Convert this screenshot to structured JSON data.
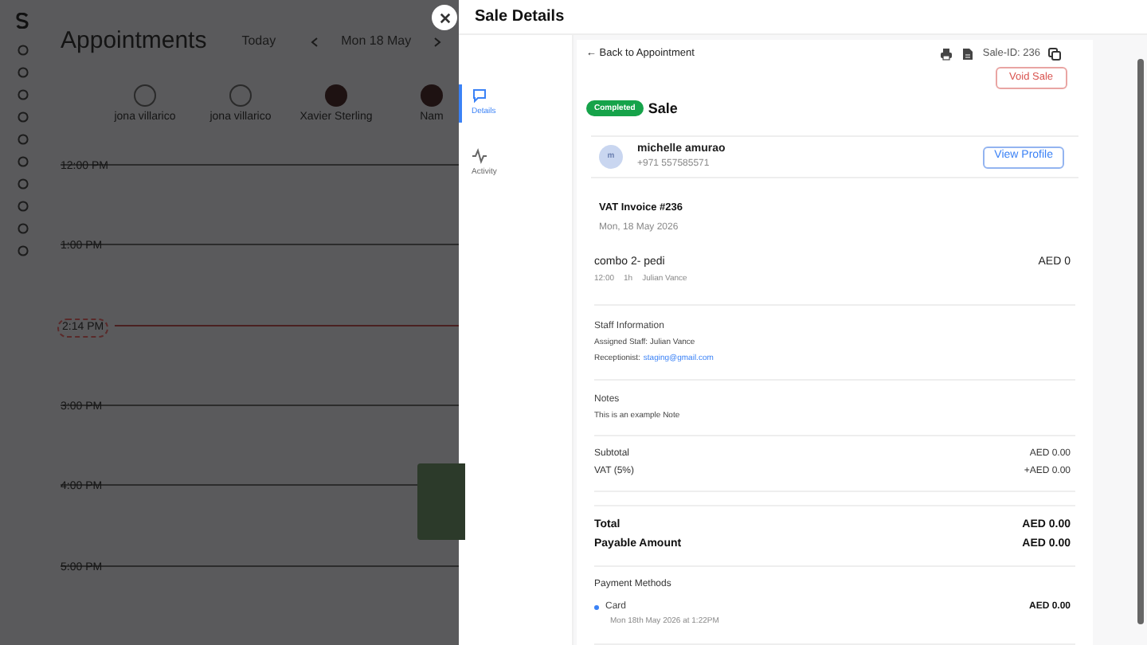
{
  "background": {
    "title": "Appointments",
    "today": "Today",
    "date": "Mon 18 May",
    "staff": [
      {
        "name": "jona villarico",
        "kind": "initial"
      },
      {
        "name": "jona villarico",
        "kind": "initial"
      },
      {
        "name": "Xavier Sterling",
        "kind": "photo"
      },
      {
        "name": "Nam",
        "kind": "photo"
      }
    ],
    "times": [
      {
        "label": "12:00 PM",
        "kind": "hour"
      },
      {
        "label": "1:00 PM",
        "kind": "hour"
      },
      {
        "label": "2:14 PM",
        "kind": "now"
      },
      {
        "label": "3:00 PM",
        "kind": "hour"
      },
      {
        "label": "4:00 PM",
        "kind": "hour"
      },
      {
        "label": "5:00 PM",
        "kind": "hour"
      }
    ]
  },
  "drawer": {
    "title": "Sale Details",
    "tabs": [
      {
        "label": "Details",
        "selected": true,
        "kind": "chat"
      },
      {
        "label": "Activity",
        "selected": false,
        "kind": "pulse"
      }
    ],
    "back_link": "← Back to Appointment",
    "sale_id": "Sale-ID: 236",
    "void_button": "Void Sale",
    "status": "Completed",
    "heading": "Sale",
    "customer": {
      "initials": "m",
      "name": "michelle amurao",
      "phone": "+971 557585571",
      "button": "View Profile"
    },
    "invoice": {
      "title": "VAT Invoice #236",
      "date": "Mon, 18 May 2026"
    },
    "items": [
      {
        "name": "combo 2- pedi",
        "time": "12:00",
        "duration": "1h",
        "staff": "Julian Vance",
        "price": "AED 0"
      }
    ],
    "staff_info": {
      "heading": "Staff Information",
      "assigned": "Assigned Staff: Julian Vance",
      "receptionist_label": "Receptionist:",
      "receptionist_email": "staging@gmail.com"
    },
    "notes": {
      "heading": "Notes",
      "text": "This is an example Note"
    },
    "summary": [
      {
        "label": "Subtotal",
        "value": "AED 0.00"
      },
      {
        "label": "VAT (5%)",
        "value": "+AED 0.00"
      }
    ],
    "totals": [
      {
        "label": "Total",
        "value": "AED 0.00"
      },
      {
        "label": "Payable Amount",
        "value": "AED 0.00"
      }
    ],
    "payment": {
      "heading": "Payment Methods",
      "methods": [
        {
          "name": "Card",
          "date": "Mon 18th May 2026 at 1:22PM",
          "amount": "AED 0.00"
        }
      ]
    }
  }
}
